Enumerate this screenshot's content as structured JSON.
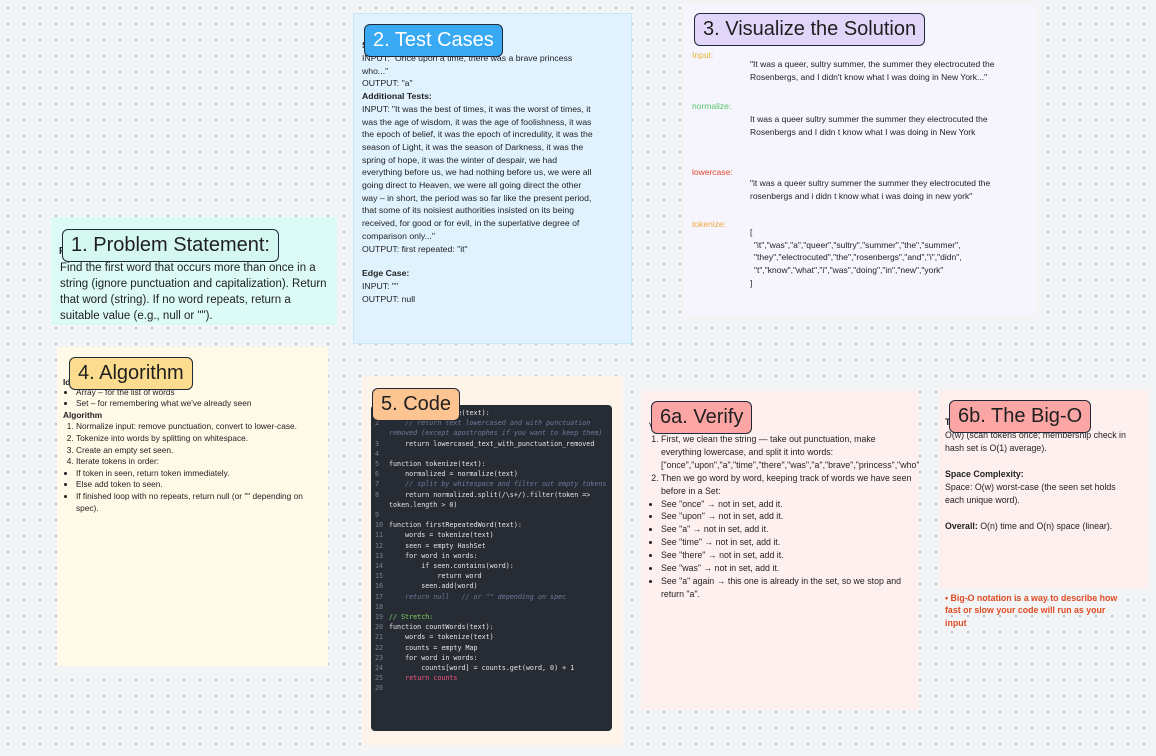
{
  "cards": {
    "problem": {
      "title": "1. Problem Statement:",
      "heading_fragment": "P",
      "body": "Find the first word that occurs more than once in a string (ignore punctuation and capitalization). Return that word (string). If no word repeats, return a suitable value (e.g., null or \"\")."
    },
    "tests": {
      "title": "2. Test Cases",
      "fragment_top": "S",
      "input_line_visible": "INPUT:  \"Once upon a time, there was a brave princess who...\"",
      "output1": "OUTPUT:  \"a\"",
      "additional_heading": "Additional Tests:",
      "input2": "INPUT:  \"It was the best of times, it was the worst of times, it was the age of wisdom, it was the age of foolishness, it was the epoch of belief, it was the epoch of incredulity, it was the season of Light, it was the season of Darkness, it was the spring of hope, it was the winter of despair, we had everything before us, we had nothing before us, we were all going direct to Heaven, we were all going direct the other way – in short, the period was so far like the present period, that some of its noisiest authorities insisted on its being received, for good or for evil, in the superlative degree of comparison only...\"",
      "output2": "OUTPUT:  first repeated: \"it\"",
      "edge_heading": "Edge Case:",
      "edge_input": "INPUT:  \"\"",
      "edge_output": "OUTPUT:  null"
    },
    "visualize": {
      "title": "3. Visualize the Solution",
      "input_label": "Input:",
      "input_text": "\"It was a queer, sultry summer, the summer they electrocuted the Rosenbergs, and I didn't know what I was doing in New York...\"",
      "normalize_label": "normalize:",
      "normalize_text": "It was a queer sultry summer the summer they electrocuted the Rosenbergs and I didn t know what I was doing in New York",
      "lowercase_label": "lowercase:",
      "lowercase_text": "\"it was a queer sultry summer the summer they electrocuted the rosenbergs and i didn t know what i was doing in new york\"",
      "tokenize_label": "tokenize:",
      "tokenize_open": "[",
      "tokenize_lines": [
        "\"it\",\"was\",\"a\",\"queer\",\"sultry\",\"summer\",\"the\",\"summer\",",
        "\"they\",\"electrocuted\",\"the\",\"rosenbergs\",\"and\",\"i\",\"didn\",",
        "\"t\",\"know\",\"what\",\"i\",\"was\",\"doing\",\"in\",\"new\",\"york\""
      ],
      "tokenize_close": "]",
      "label_colors": {
        "input": "#e2b431",
        "normalize": "#58c66b",
        "lowercase": "#e2462c",
        "tokenize": "#f2a93b"
      }
    },
    "algorithm": {
      "title": "4. Algorithm",
      "fragment_top": "Id",
      "ds_items": [
        "Array – for the list of words",
        "Set – for remembering what we've already seen"
      ],
      "heading": "Algorithm",
      "steps": [
        "Normalize input: remove punctuation, convert to lower-case.",
        "Tokenize into words by splitting on whitespace.",
        "Create an empty set seen.",
        "Iterate tokens in order:"
      ],
      "sub_steps": [
        "If token in seen, return token immediately.",
        "Else add token to seen.",
        "If finished loop with no repeats, return null (or \"\" depending on spec)."
      ]
    },
    "code": {
      "title": "5. Code",
      "lines": [
        {
          "n": "",
          "t": "function normalize(text):",
          "c": ""
        },
        {
          "n": "2",
          "t": "    // return text lowercased and with punctuation removed (except apostrophes if you want to keep them)",
          "c": "cm"
        },
        {
          "n": "3",
          "t": "    return lowercased_text_with_punctuation_removed",
          "c": ""
        },
        {
          "n": "4",
          "t": "",
          "c": ""
        },
        {
          "n": "5",
          "t": "function tokenize(text):",
          "c": ""
        },
        {
          "n": "6",
          "t": "    normalized = normalize(text)",
          "c": ""
        },
        {
          "n": "7",
          "t": "    // split by whitespace and filter out empty tokens",
          "c": "cm"
        },
        {
          "n": "8",
          "t": "    return normalized.split(/\\s+/).filter(token => token.length > 0)",
          "c": ""
        },
        {
          "n": "9",
          "t": "",
          "c": ""
        },
        {
          "n": "10",
          "t": "function firstRepeatedWord(text):",
          "c": ""
        },
        {
          "n": "11",
          "t": "    words = tokenize(text)",
          "c": ""
        },
        {
          "n": "12",
          "t": "    seen = empty HashSet",
          "c": ""
        },
        {
          "n": "13",
          "t": "    for word in words:",
          "c": ""
        },
        {
          "n": "14",
          "t": "        if seen.contains(word):",
          "c": ""
        },
        {
          "n": "15",
          "t": "            return word",
          "c": ""
        },
        {
          "n": "16",
          "t": "        seen.add(word)",
          "c": ""
        },
        {
          "n": "17",
          "t": "    return null   // or \"\" depending on spec",
          "c": "cm"
        },
        {
          "n": "18",
          "t": "",
          "c": ""
        },
        {
          "n": "19",
          "t": "// Stretch:",
          "c": "fn"
        },
        {
          "n": "20",
          "t": "function countWords(text):",
          "c": ""
        },
        {
          "n": "21",
          "t": "    words = tokenize(text)",
          "c": ""
        },
        {
          "n": "22",
          "t": "    counts = empty Map",
          "c": ""
        },
        {
          "n": "23",
          "t": "    for word in words:",
          "c": ""
        },
        {
          "n": "24",
          "t": "        counts[word] = counts.get(word, 0) + 1",
          "c": ""
        },
        {
          "n": "25",
          "t": "    return counts",
          "c": "kw"
        },
        {
          "n": "26",
          "t": "",
          "c": ""
        }
      ]
    },
    "verify": {
      "title": "6a. Verify",
      "fragment_top": "V",
      "steps": [
        "First, we clean the string — take out punctuation, make everything lowercase, and split it into words: [\"once\",\"upon\",\"a\",\"time\",\"there\",\"was\",\"a\",\"brave\",\"princess\",\"who\"]",
        "Then we go word by word, keeping track of words we have seen before in a Set:"
      ],
      "bullets": [
        "See \"once\" → not in set, add it.",
        "See \"upon\" → not in set, add it.",
        "See \"a\" → not in set, add it.",
        "See \"time\" → not in set, add it.",
        "See \"there\" → not in set, add it.",
        "See \"was\" → not in set, add it.",
        "See \"a\" again → this one is already in the set, so we stop and return \"a\"."
      ]
    },
    "bigo": {
      "title": "6b. The Big-O",
      "fragment_top": "T",
      "time_text": "O(w) (scan tokens once; membership check in hash set is O(1) average).",
      "space_heading": "Space Complexity:",
      "space_text": "Space: O(w) worst-case (the seen set holds each unique word).",
      "overall_label": "Overall:",
      "overall_text": "O(n) time and O(n) space (linear).",
      "note": "Big-O notation is a way to describe how fast or slow your code will run as your input"
    }
  }
}
